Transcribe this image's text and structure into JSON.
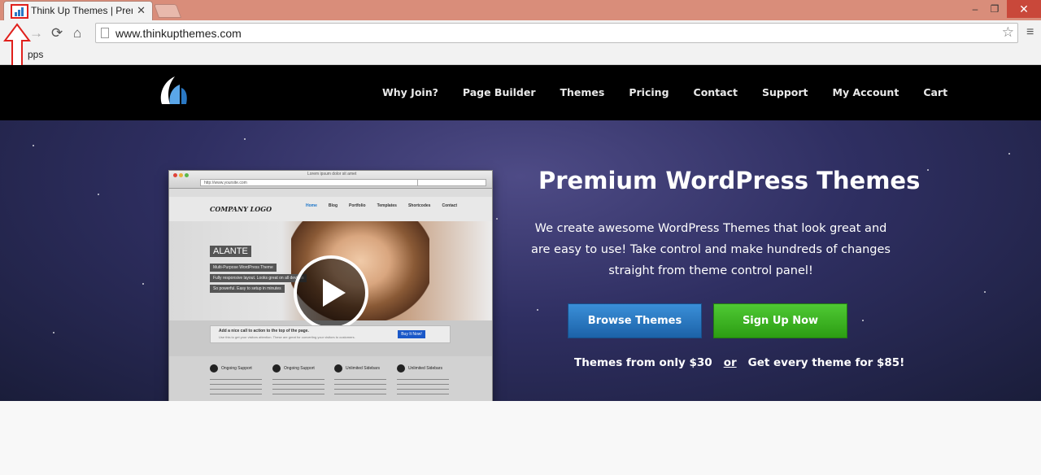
{
  "browser": {
    "tab_title": "Think Up Themes | Premium",
    "tab_close": "✕",
    "url": "www.thinkupthemes.com",
    "bookmark_apps": "pps",
    "win_min": "–",
    "win_max": "❐",
    "win_close": "✕",
    "back": "←",
    "forward": "→",
    "reload": "⟳",
    "home": "⌂",
    "star": "☆",
    "menu": "≡"
  },
  "nav": {
    "items": [
      "Why Join?",
      "Page Builder",
      "Themes",
      "Pricing",
      "Contact",
      "Support",
      "My Account",
      "Cart"
    ]
  },
  "hero": {
    "title": "Premium WordPress Themes",
    "text": "We create awesome WordPress Themes that look great and are easy to use! Take control and make hundreds of changes straight from theme control panel!",
    "browse_label": "Browse Themes",
    "signup_label": "Sign Up Now",
    "price_left": "Themes from only $30",
    "price_or": "or",
    "price_right": "Get every theme for $85!"
  },
  "preview": {
    "chrome_title": "Lorem ipsum dolor sit amet",
    "url": "http://www.yoursite.com",
    "logo": "COMPANY LOGO",
    "nav": [
      "Home",
      "Blog",
      "Portfolio",
      "Templates",
      "Shortcodes",
      "Contact"
    ],
    "slide_title": "ALANTE",
    "slide_tags": [
      "Multi-Purpose WordPress Theme",
      "Fully responsive layout. Looks great on all devices",
      "So powerful. Easy to setup in minutes"
    ],
    "cta_heading": "Add a nice call to action to the top of the page.",
    "cta_sub": "Use this to get your visitors attention. These are great for converting your visitors to customers.",
    "cta_button": "Buy It Now!",
    "features": [
      "Ongoing Support",
      "Ongoing Support",
      "Unlimited Sidebars",
      "Unlimited Sidebars"
    ]
  },
  "colors": {
    "browse_button": "#2a78c4",
    "signup_button": "#3db424",
    "header_bg": "#000000",
    "titlebar": "#d98d7a"
  }
}
